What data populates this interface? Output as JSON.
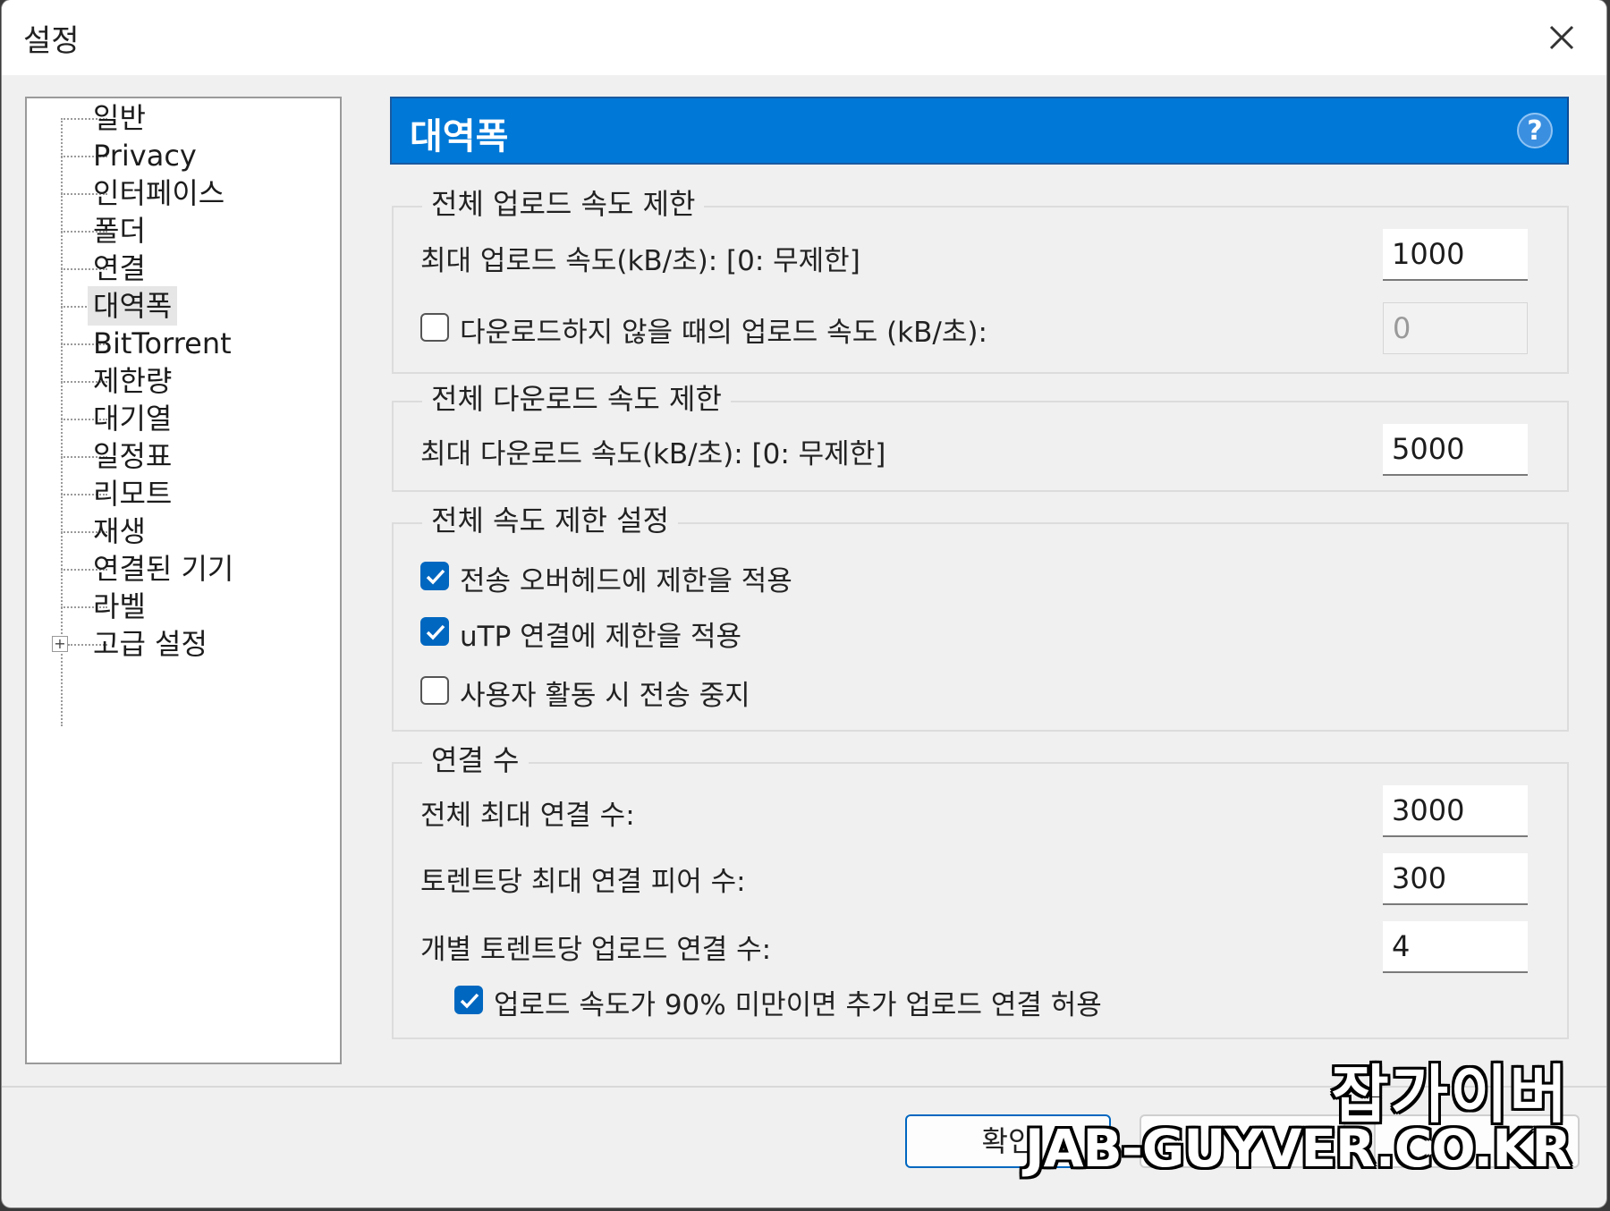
{
  "window": {
    "title": "설정"
  },
  "tree": {
    "items": [
      {
        "label": "일반"
      },
      {
        "label": "Privacy"
      },
      {
        "label": "인터페이스"
      },
      {
        "label": "폴더"
      },
      {
        "label": "연결"
      },
      {
        "label": "대역폭",
        "selected": true
      },
      {
        "label": "BitTorrent"
      },
      {
        "label": "제한량"
      },
      {
        "label": "대기열"
      },
      {
        "label": "일정표"
      },
      {
        "label": "리모트"
      },
      {
        "label": "재생"
      },
      {
        "label": "연결된 기기"
      },
      {
        "label": "라벨"
      },
      {
        "label": "고급 설정",
        "expandable": true
      }
    ]
  },
  "panel": {
    "title": "대역폭",
    "help_icon": "?"
  },
  "upload_group": {
    "title": "전체 업로드 속도 제한",
    "max_upload_label": "최대 업로드 속도(kB/초): [0: 무제한]",
    "max_upload_value": "1000",
    "idle_upload_label": "다운로드하지 않을 때의 업로드 속도 (kB/초):",
    "idle_upload_checked": false,
    "idle_upload_value": "0"
  },
  "download_group": {
    "title": "전체 다운로드 속도 제한",
    "max_download_label": "최대 다운로드 속도(kB/초): [0: 무제한]",
    "max_download_value": "5000"
  },
  "global_group": {
    "title": "전체 속도 제한 설정",
    "overhead_label": "전송 오버헤드에 제한을 적용",
    "overhead_checked": true,
    "utp_label": "uTP 연결에 제한을 적용",
    "utp_checked": true,
    "pause_label": "사용자 활동 시 전송 중지",
    "pause_checked": false
  },
  "connections_group": {
    "title": "연결 수",
    "global_max_label": "전체 최대 연결 수:",
    "global_max_value": "3000",
    "per_torrent_label": "토렌트당 최대 연결 피어 수:",
    "per_torrent_value": "300",
    "upload_slots_label": "개별 토렌트당 업로드 연결 수:",
    "upload_slots_value": "4",
    "extra_slots_label": "업로드 속도가 90% 미만이면 추가 업로드 연결 허용",
    "extra_slots_checked": true
  },
  "footer": {
    "ok_label": "확인"
  },
  "watermark": {
    "name": "잡가이버",
    "url": "JAB-GUYVER.CO.KR"
  },
  "colors": {
    "accent": "#0078d7",
    "check": "#0067c0"
  }
}
